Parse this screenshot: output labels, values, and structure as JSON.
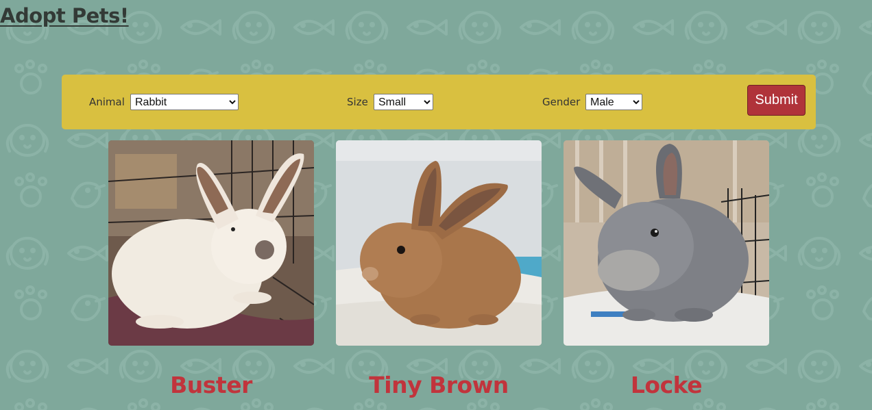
{
  "page": {
    "title": "Adopt Pets!"
  },
  "filters": {
    "animal": {
      "label": "Animal",
      "selected": "Rabbit"
    },
    "size": {
      "label": "Size",
      "selected": "Small"
    },
    "gender": {
      "label": "Gender",
      "selected": "Male"
    },
    "submit_label": "Submit"
  },
  "pets": [
    {
      "name": "Buster",
      "photo": "white-rabbit-photo"
    },
    {
      "name": "Tiny Brown",
      "photo": "brown-rabbit-photo"
    },
    {
      "name": "Locke",
      "photo": "gray-rabbit-photo"
    }
  ],
  "colors": {
    "background": "#7fa89b",
    "filter_bar": "#d9c040",
    "submit_button": "#b0333a",
    "pet_name": "#c1343c",
    "title": "#333a36"
  }
}
